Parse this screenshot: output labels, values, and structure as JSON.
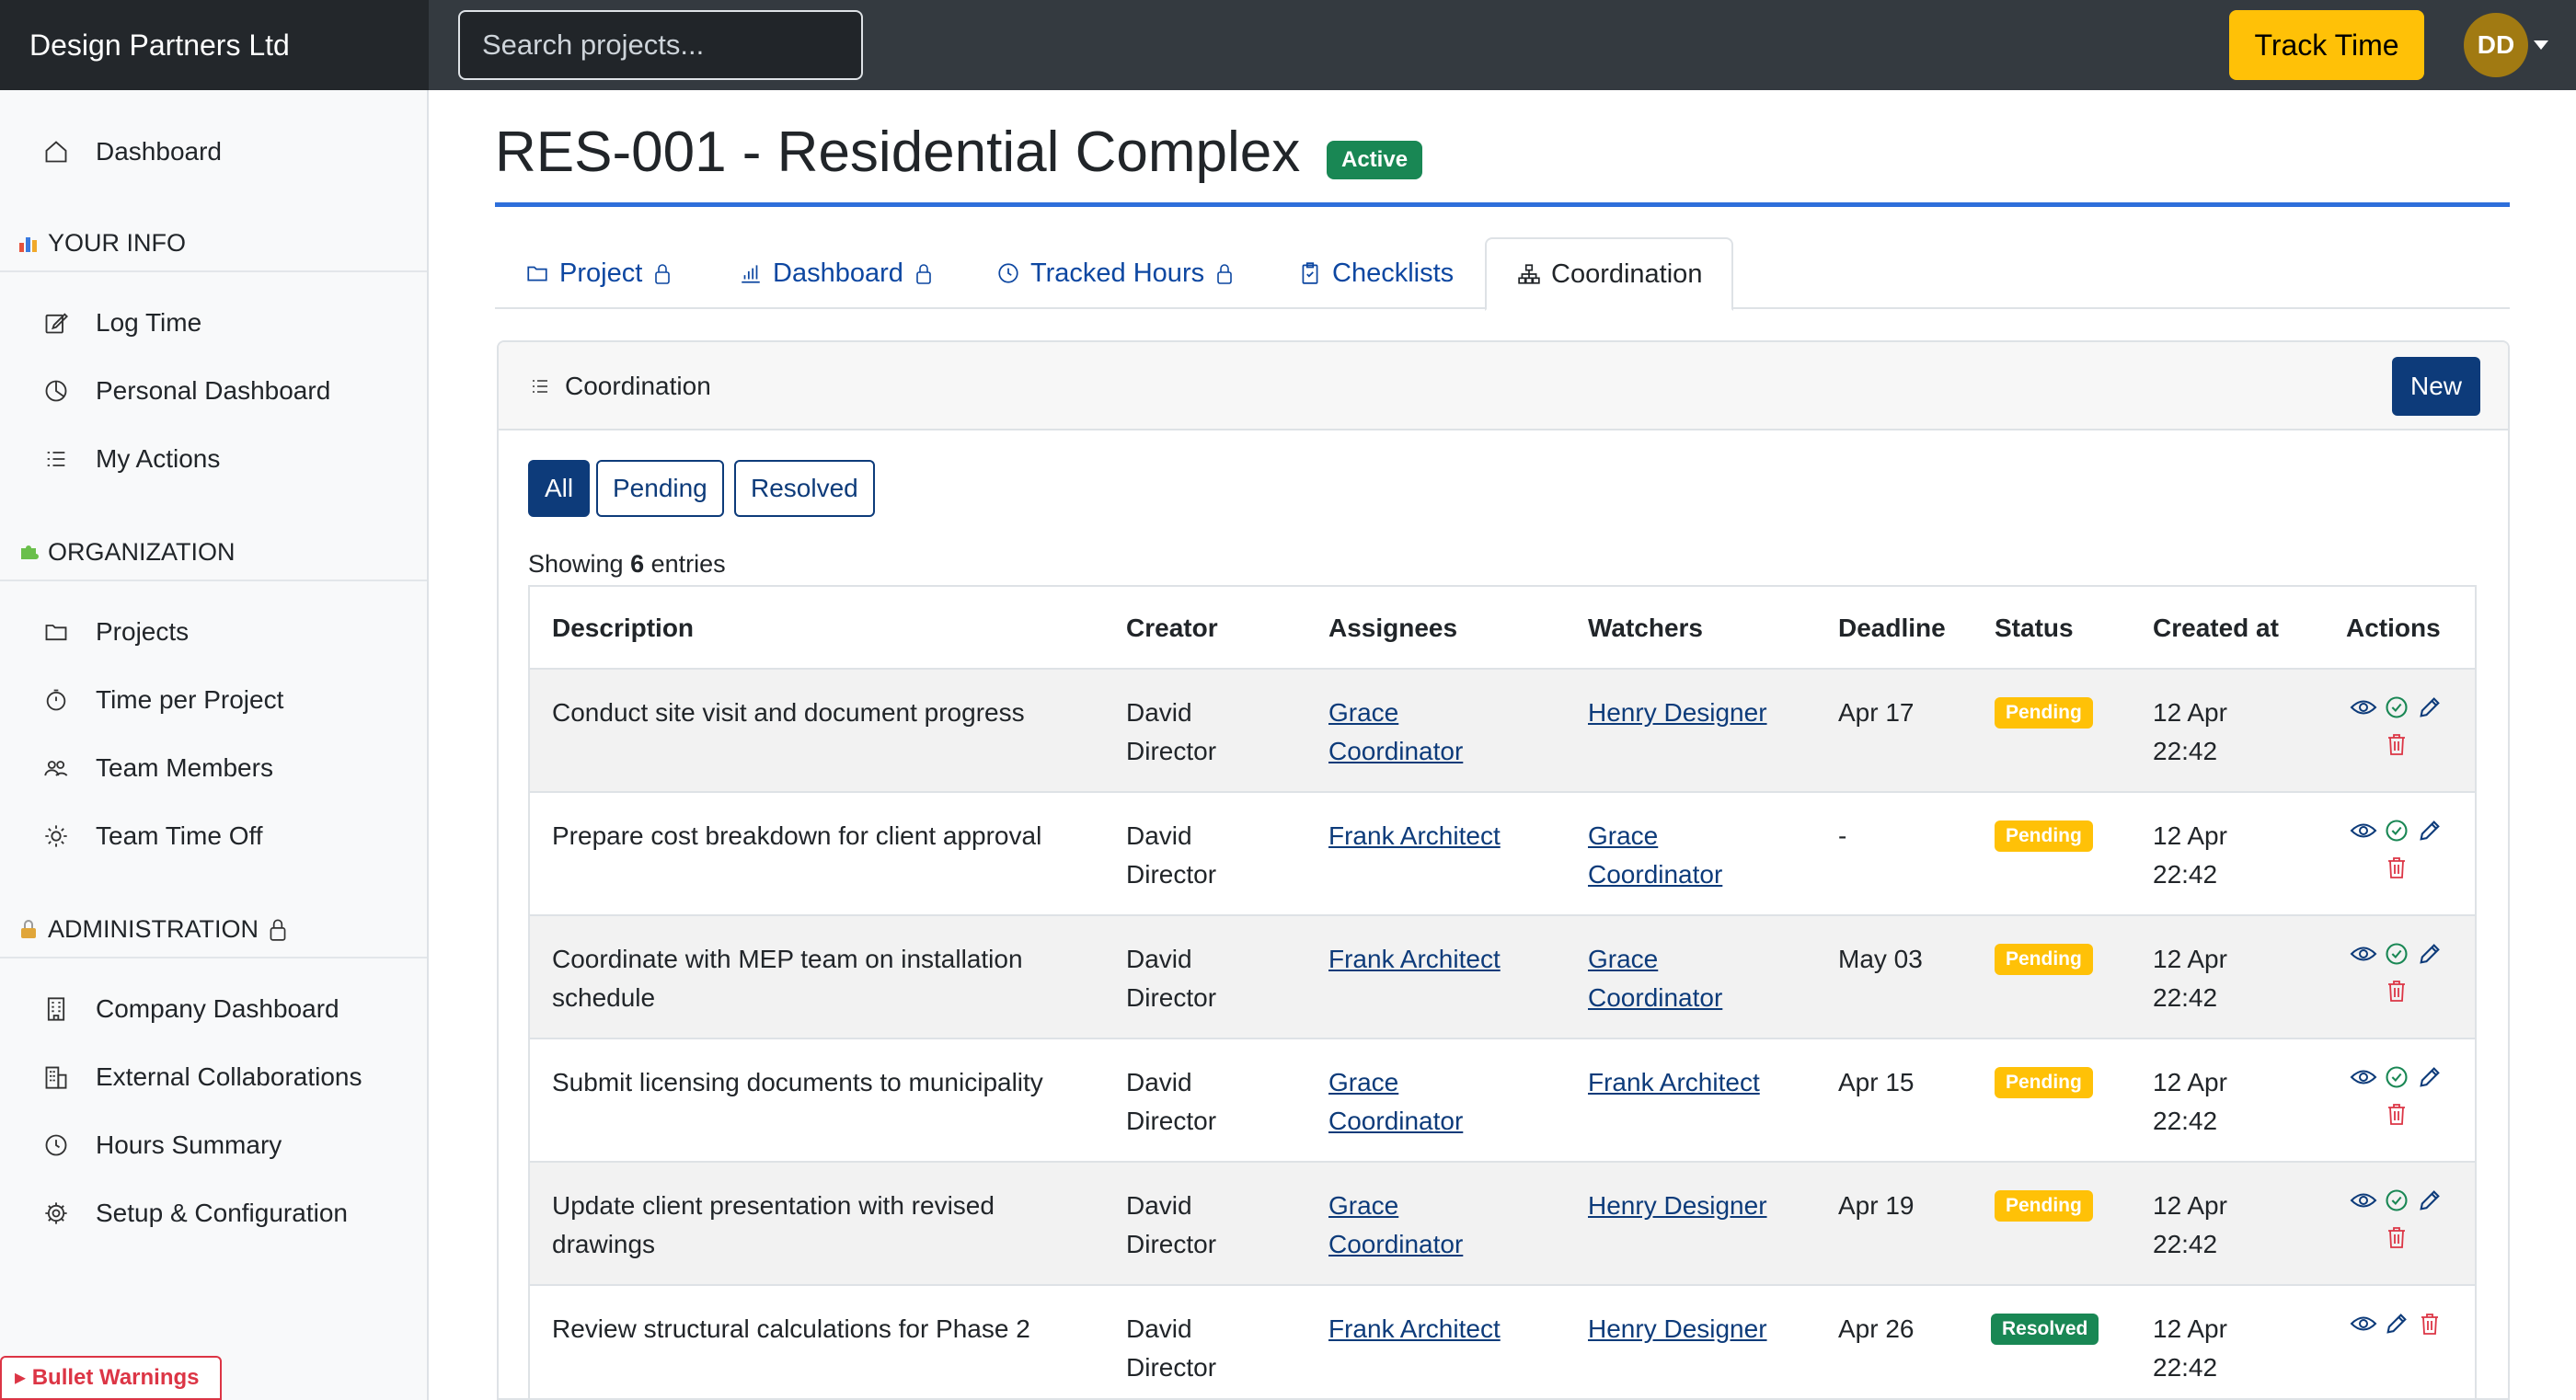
{
  "app": {
    "brand": "Design Partners Ltd",
    "search_placeholder": "Search projects...",
    "track_time_label": "Track Time",
    "avatar_initials": "DD"
  },
  "sidebar": {
    "dashboard": "Dashboard",
    "sections": [
      {
        "heading": "YOUR INFO",
        "items": [
          "Log Time",
          "Personal Dashboard",
          "My Actions"
        ]
      },
      {
        "heading": "ORGANIZATION",
        "items": [
          "Projects",
          "Time per Project",
          "Team Members",
          "Team Time Off"
        ]
      },
      {
        "heading": "ADMINISTRATION",
        "items": [
          "Company Dashboard",
          "External Collaborations",
          "Hours Summary",
          "Setup & Configuration"
        ]
      }
    ],
    "bullet_warnings": "▸ Bullet Warnings"
  },
  "page": {
    "title": "RES-001 - Residential Complex",
    "status_badge": "Active",
    "accent_color": "#2e6fdb"
  },
  "tabs": [
    "Project",
    "Dashboard",
    "Tracked Hours",
    "Checklists",
    "Coordination"
  ],
  "coordination": {
    "title": "Coordination",
    "new_label": "New",
    "filters": [
      "All",
      "Pending",
      "Resolved"
    ],
    "showing_prefix": "Showing",
    "showing_count": "6",
    "showing_suffix": "entries",
    "columns": [
      "Description",
      "Creator",
      "Assignees",
      "Watchers",
      "Deadline",
      "Status",
      "Created at",
      "Actions"
    ],
    "rows": [
      {
        "description": [
          "Conduct site visit and document progress"
        ],
        "creator": [
          "David",
          "Director"
        ],
        "assignees": [
          "Grace",
          "Coordinator"
        ],
        "watchers": [
          "Henry Designer"
        ],
        "deadline": "Apr 17",
        "status": "Pending",
        "created": [
          "12 Apr",
          "22:42"
        ]
      },
      {
        "description": [
          "Prepare cost breakdown for client approval"
        ],
        "creator": [
          "David",
          "Director"
        ],
        "assignees": [
          "Frank Architect"
        ],
        "watchers": [
          "Grace",
          "Coordinator"
        ],
        "deadline": "-",
        "status": "Pending",
        "created": [
          "12 Apr",
          "22:42"
        ]
      },
      {
        "description": [
          "Coordinate with MEP team on installation",
          "schedule"
        ],
        "creator": [
          "David",
          "Director"
        ],
        "assignees": [
          "Frank Architect"
        ],
        "watchers": [
          "Grace",
          "Coordinator"
        ],
        "deadline": "May 03",
        "status": "Pending",
        "created": [
          "12 Apr",
          "22:42"
        ]
      },
      {
        "description": [
          "Submit licensing documents to municipality"
        ],
        "creator": [
          "David",
          "Director"
        ],
        "assignees": [
          "Grace",
          "Coordinator"
        ],
        "watchers": [
          "Frank Architect"
        ],
        "deadline": "Apr 15",
        "status": "Pending",
        "created": [
          "12 Apr",
          "22:42"
        ]
      },
      {
        "description": [
          "Update client presentation with revised",
          "drawings"
        ],
        "creator": [
          "David",
          "Director"
        ],
        "assignees": [
          "Grace",
          "Coordinator"
        ],
        "watchers": [
          "Henry Designer"
        ],
        "deadline": "Apr 19",
        "status": "Pending",
        "created": [
          "12 Apr",
          "22:42"
        ]
      },
      {
        "description": [
          "Review structural calculations for Phase 2"
        ],
        "creator": [
          "David",
          "Director"
        ],
        "assignees": [
          "Frank Architect"
        ],
        "watchers": [
          "Henry Designer"
        ],
        "deadline": "Apr 26",
        "status": "Resolved",
        "created": [
          "12 Apr",
          "22:42"
        ]
      }
    ]
  }
}
